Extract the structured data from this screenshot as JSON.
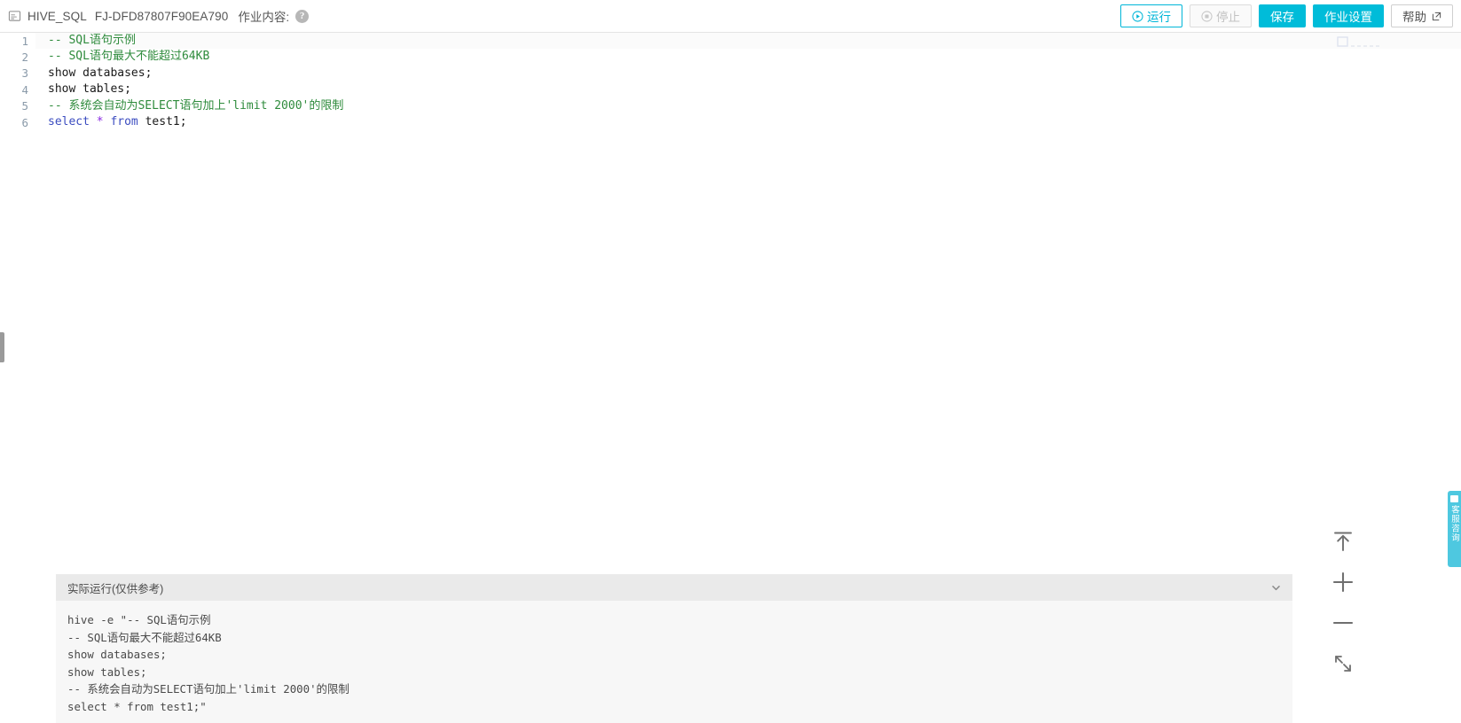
{
  "toolbar": {
    "doc_icon": "document-icon",
    "job_type": "HIVE_SQL",
    "job_id": "FJ-DFD87807F90EA790",
    "content_label": "作业内容:",
    "help_badge": "?",
    "buttons": {
      "run": "运行",
      "stop": "停止",
      "save": "保存",
      "job_settings": "作业设置",
      "help": "帮助"
    },
    "colors": {
      "accent": "#00bcd9",
      "accent_outline": "#00b6d8",
      "disabled_text": "#c2c2c2"
    }
  },
  "editor": {
    "lines": [
      {
        "number": "1",
        "tokens": [
          {
            "t": "-- SQL语句示例",
            "c": "tok-comment"
          }
        ]
      },
      {
        "number": "2",
        "tokens": [
          {
            "t": "-- SQL语句最大不能超过64KB",
            "c": "tok-comment"
          }
        ]
      },
      {
        "number": "3",
        "tokens": [
          {
            "t": "show databases;",
            "c": "tok-plain"
          }
        ]
      },
      {
        "number": "4",
        "tokens": [
          {
            "t": "show tables;",
            "c": "tok-plain"
          }
        ]
      },
      {
        "number": "5",
        "tokens": [
          {
            "t": "-- 系统会自动为SELECT语句加上'limit 2000'的限制",
            "c": "tok-comment"
          }
        ]
      },
      {
        "number": "6",
        "tokens": [
          {
            "t": "select",
            "c": "tok-kw"
          },
          {
            "t": " ",
            "c": "tok-plain"
          },
          {
            "t": "*",
            "c": "tok-op"
          },
          {
            "t": " ",
            "c": "tok-plain"
          },
          {
            "t": "from",
            "c": "tok-kw"
          },
          {
            "t": " test1;",
            "c": "tok-plain"
          }
        ]
      }
    ]
  },
  "output": {
    "title": "实际运行(仅供参考)",
    "chevron_icon": "chevron-down-icon",
    "lines": [
      "hive -e \"-- SQL语句示例",
      "-- SQL语句最大不能超过64KB",
      "show databases;",
      "show tables;",
      "-- 系统会自动为SELECT语句加上'limit 2000'的限制",
      "select * from test1;\""
    ]
  },
  "float_controls": [
    {
      "name": "scroll-to-top-icon",
      "label": "置顶"
    },
    {
      "name": "zoom-in-icon",
      "label": "放大"
    },
    {
      "name": "zoom-out-icon",
      "label": "缩小"
    },
    {
      "name": "fullscreen-icon",
      "label": "全屏"
    }
  ],
  "service_tab": {
    "icon": "headset-icon",
    "text": "客服咨询"
  }
}
